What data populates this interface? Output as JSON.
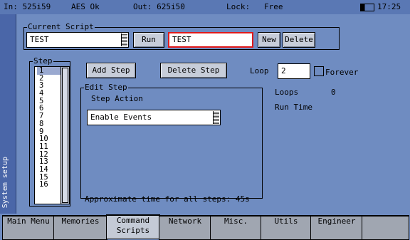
{
  "status": {
    "input": "In: 525i59",
    "aes": "AES Ok",
    "output": "Out: 625i50",
    "lock": "Lock:   Free",
    "time": "17:25"
  },
  "side_label": "System setup",
  "current_script": {
    "group_label": "Current Script",
    "selected": "TEST",
    "run_label": "Run",
    "name_value": "TEST",
    "new_label": "New",
    "delete_label": "Delete"
  },
  "step": {
    "group_label": "Step",
    "items": [
      "1",
      "2",
      "3",
      "4",
      "5",
      "6",
      "7",
      "8",
      "9",
      "10",
      "11",
      "12",
      "13",
      "14",
      "15",
      "16"
    ]
  },
  "add_step_label": "Add Step",
  "delete_step_label": "Delete Step",
  "loop": {
    "label": "Loop",
    "value": "2",
    "forever_label": "Forever"
  },
  "edit_step": {
    "group_label": "Edit Step",
    "action_label": "Step Action",
    "action_value": "Enable Events"
  },
  "loops": {
    "label": "Loops",
    "value": "0"
  },
  "run_time_label": "Run Time",
  "approx_time": "Approximate time for all steps: 45s",
  "tabs": [
    {
      "label": "Main Menu"
    },
    {
      "label": "Memories"
    },
    {
      "label": "Command\nScripts"
    },
    {
      "label": "Network"
    },
    {
      "label": "Misc."
    },
    {
      "label": "Utils"
    },
    {
      "label": "Engineer"
    }
  ]
}
